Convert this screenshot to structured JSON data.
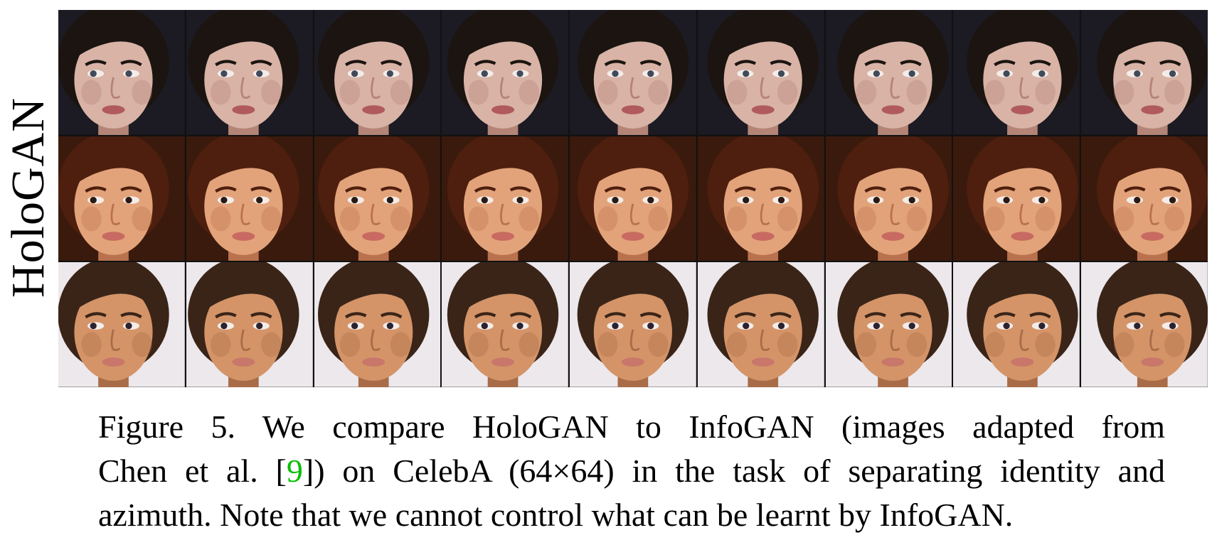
{
  "figure": {
    "row_label": "HoloGAN",
    "rows": [
      {
        "tones": {
          "bg": "#1c1a22",
          "hair": "#1b1410",
          "skin": "#d8b3a6",
          "shade": "#b48476",
          "lips": "#b05a5e",
          "eyes": "#3f4a5a"
        },
        "tiles": [
          "face",
          "face",
          "face",
          "face",
          "face",
          "face",
          "face",
          "face",
          "face"
        ]
      },
      {
        "tones": {
          "bg": "#3a1a0c",
          "hair": "#4e1f0e",
          "skin": "#e3a37a",
          "shade": "#b9724d",
          "lips": "#c86a62",
          "eyes": "#2a1a14"
        },
        "tiles": [
          "face",
          "face",
          "face",
          "face",
          "face",
          "face",
          "face",
          "face",
          "face"
        ]
      },
      {
        "tones": {
          "bg": "#ece8ec",
          "hair": "#3a2418",
          "skin": "#d49468",
          "shade": "#a86c48",
          "lips": "#c8776a",
          "eyes": "#2b2230"
        },
        "tiles": [
          "face",
          "face",
          "face",
          "face",
          "face",
          "face",
          "face",
          "face",
          "face"
        ]
      }
    ]
  },
  "caption": {
    "line1": "Figure 5. We compare HoloGAN to InfoGAN (images adapted from",
    "line2_before": "Chen et al. [",
    "line2_ref": "9",
    "line2_after": "]) on CelebA (64×64) in the task of separating identity and",
    "line3": "azimuth. Note that we cannot control what can be learnt by InfoGAN.",
    "ref_color": "#00c000"
  }
}
